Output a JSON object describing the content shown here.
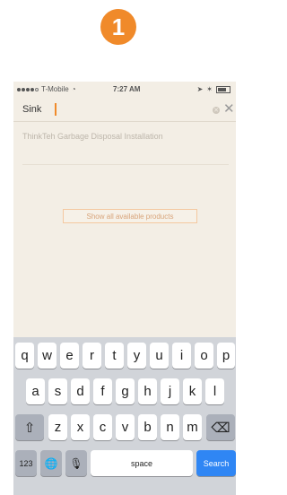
{
  "step": {
    "number": "1"
  },
  "status_bar": {
    "carrier": "T-Mobile",
    "time": "7:27 AM"
  },
  "search": {
    "query": "Sink",
    "placeholder": ""
  },
  "results": [
    {
      "title": "ThinkTeh Garbage Disposal Installation"
    }
  ],
  "actions": {
    "show_all_label": "Show all available products"
  },
  "keyboard": {
    "row1": [
      "q",
      "w",
      "e",
      "r",
      "t",
      "y",
      "u",
      "i",
      "o",
      "p"
    ],
    "row2": [
      "a",
      "s",
      "d",
      "f",
      "g",
      "h",
      "j",
      "k",
      "l"
    ],
    "row3": [
      "z",
      "x",
      "c",
      "v",
      "b",
      "n",
      "m"
    ],
    "numbers_label": "123",
    "space_label": "space",
    "search_label": "Search"
  },
  "colors": {
    "accent": "#f08a2a",
    "background": "#f3eee5",
    "keyboard_bg": "#d1d4d9",
    "search_key": "#2f86f4"
  }
}
